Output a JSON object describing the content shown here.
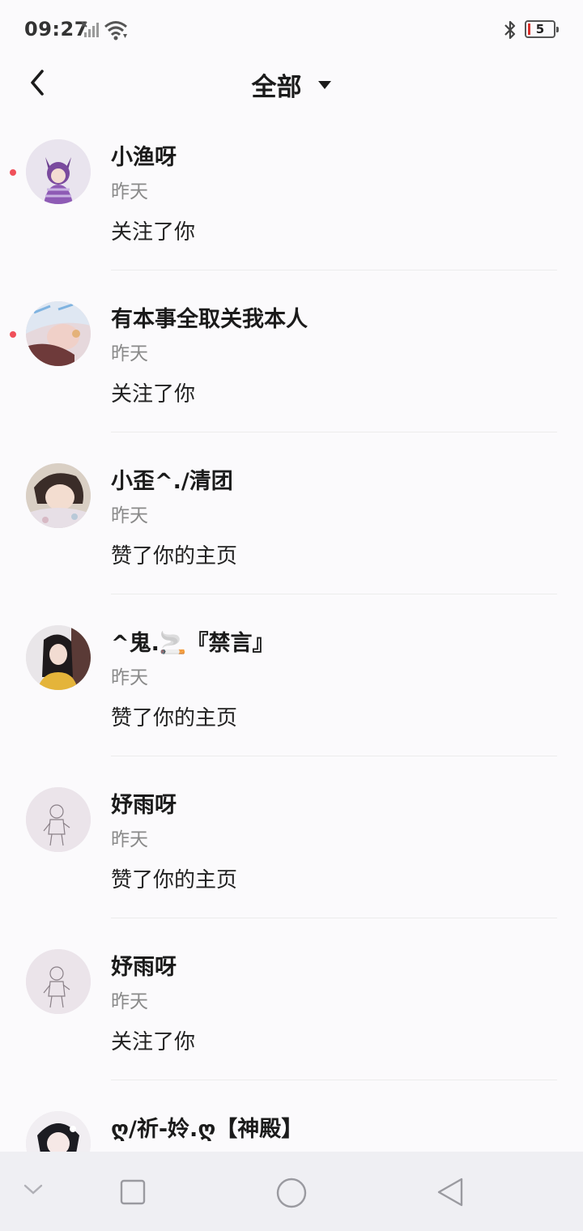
{
  "status_bar": {
    "time": "09:27",
    "battery_level": "5",
    "icons": [
      "signal-off-icon",
      "wifi-icon",
      "bluetooth-icon",
      "battery-icon"
    ]
  },
  "header": {
    "back_icon": "chevron-left-icon",
    "title": "全部",
    "dropdown_icon": "caret-down-icon"
  },
  "notifications": [
    {
      "name": "小渔呀",
      "time": "昨天",
      "action": "关注了你",
      "unread": true
    },
    {
      "name": "有本事全取关我本人",
      "time": "昨天",
      "action": "关注了你",
      "unread": true
    },
    {
      "name": "小歪^./清团",
      "time": "昨天",
      "action": "赞了你的主页",
      "unread": false
    },
    {
      "name": "^鬼.🚬『禁言』",
      "time": "昨天",
      "action": "赞了你的主页",
      "unread": false
    },
    {
      "name": "妤雨呀",
      "time": "昨天",
      "action": "赞了你的主页",
      "unread": false
    },
    {
      "name": "妤雨呀",
      "time": "昨天",
      "action": "关注了你",
      "unread": false
    },
    {
      "name": "ღ/祈-姈.ღ【神殿】",
      "time": "",
      "action": "",
      "unread": false
    }
  ],
  "nav_bar": {
    "icons": [
      "chevron-down-icon",
      "square-icon",
      "circle-icon",
      "triangle-back-icon"
    ]
  },
  "colors": {
    "background": "#fbfafc",
    "unread_dot": "#f0505a",
    "battery_low": "#d9302c",
    "nav_bar": "#efeff3"
  }
}
